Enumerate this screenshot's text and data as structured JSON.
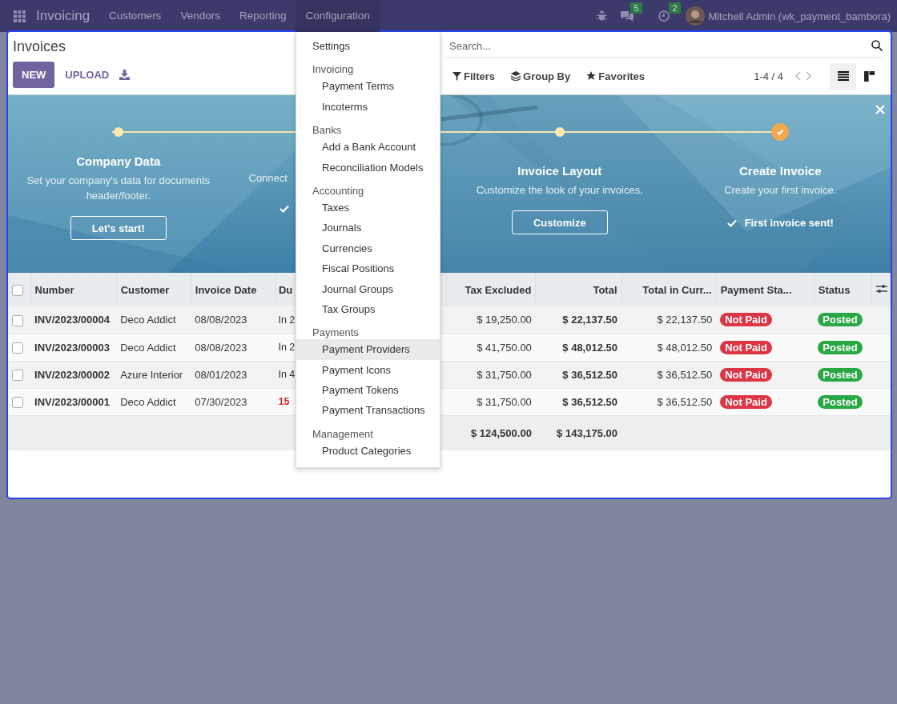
{
  "navbar": {
    "app_name": "Invoicing",
    "menus": [
      {
        "label": "Customers",
        "selected": false
      },
      {
        "label": "Vendors",
        "selected": false
      },
      {
        "label": "Reporting",
        "selected": false
      },
      {
        "label": "Configuration",
        "selected": true
      }
    ],
    "messages_badge": "5",
    "activities_badge": "2",
    "user": "Mitchell Admin (wk_payment_bambora)"
  },
  "control_panel": {
    "title": "Invoices",
    "new_button": "NEW",
    "upload_button": "UPLOAD",
    "search": {
      "placeholder": "Search..."
    },
    "filters": "Filters",
    "group_by": "Group By",
    "favorites": "Favorites",
    "pager": "1-4 / 4",
    "views": [
      {
        "kind": "list",
        "selected": true
      },
      {
        "kind": "kanban",
        "selected": false
      }
    ]
  },
  "onboarding": {
    "steps": [
      {
        "title": "Company Data",
        "description": "Set your company's data for documents header/footer.",
        "button": "Let's start!",
        "done": false
      },
      {
        "description": "Connect",
        "done": true
      },
      {
        "title": "Invoice Layout",
        "description": "Customize the look of your invoices.",
        "button": "Customize",
        "done": false
      },
      {
        "title": "Create Invoice",
        "description": "Create your first invoice.",
        "done": true,
        "done_label": "First invoice sent!"
      }
    ]
  },
  "table": {
    "select_all_checked": false,
    "columns": [
      "Number",
      "Customer",
      "Invoice Date",
      "Du",
      "Tax Excluded",
      "Total",
      "Total in Curr...",
      "Payment Sta...",
      "Status"
    ],
    "rows": [
      {
        "checked": false,
        "number": "INV/2023/00004",
        "customer": "Deco Addict",
        "invoice_date": "08/08/2023",
        "due": "In 2",
        "overdue": false,
        "tax_excluded": "$ 19,250.00",
        "total": "$ 22,137.50",
        "total_currency": "$ 22,137.50",
        "payment_status": {
          "label": "Not Paid",
          "color": "#dc3545"
        },
        "status": {
          "label": "Posted",
          "color": "#28a745"
        }
      },
      {
        "checked": false,
        "number": "INV/2023/00003",
        "customer": "Deco Addict",
        "invoice_date": "08/08/2023",
        "due": "In 2",
        "overdue": false,
        "tax_excluded": "$ 41,750.00",
        "total": "$ 48,012.50",
        "total_currency": "$ 48,012.50",
        "payment_status": {
          "label": "Not Paid",
          "color": "#dc3545"
        },
        "status": {
          "label": "Posted",
          "color": "#28a745"
        }
      },
      {
        "checked": false,
        "number": "INV/2023/00002",
        "customer": "Azure Interior",
        "invoice_date": "08/01/2023",
        "due": "In 4",
        "overdue": false,
        "tax_excluded": "$ 31,750.00",
        "total": "$ 36,512.50",
        "total_currency": "$ 36,512.50",
        "payment_status": {
          "label": "Not Paid",
          "color": "#dc3545"
        },
        "status": {
          "label": "Posted",
          "color": "#28a745"
        }
      },
      {
        "checked": false,
        "number": "INV/2023/00001",
        "customer": "Deco Addict",
        "invoice_date": "07/30/2023",
        "due": "15",
        "overdue": true,
        "tax_excluded": "$ 31,750.00",
        "total": "$ 36,512.50",
        "total_currency": "$ 36,512.50",
        "payment_status": {
          "label": "Not Paid",
          "color": "#dc3545"
        },
        "status": {
          "label": "Posted",
          "color": "#28a745"
        }
      }
    ],
    "totals": {
      "tax_excluded": "$ 124,500.00",
      "total": "$ 143,175.00"
    }
  },
  "config_menu": {
    "items": [
      {
        "kind": "item",
        "label": "Settings",
        "selected": false
      },
      {
        "kind": "header",
        "label": "Invoicing"
      },
      {
        "kind": "subitem",
        "label": "Payment Terms",
        "selected": false
      },
      {
        "kind": "subitem",
        "label": "Incoterms",
        "selected": false
      },
      {
        "kind": "header",
        "label": "Banks"
      },
      {
        "kind": "subitem",
        "label": "Add a Bank Account",
        "selected": false
      },
      {
        "kind": "subitem",
        "label": "Reconciliation Models",
        "selected": false
      },
      {
        "kind": "header",
        "label": "Accounting"
      },
      {
        "kind": "subitem",
        "label": "Taxes",
        "selected": false
      },
      {
        "kind": "subitem",
        "label": "Journals",
        "selected": false
      },
      {
        "kind": "subitem",
        "label": "Currencies",
        "selected": false
      },
      {
        "kind": "subitem",
        "label": "Fiscal Positions",
        "selected": false
      },
      {
        "kind": "subitem",
        "label": "Journal Groups",
        "selected": false
      },
      {
        "kind": "subitem",
        "label": "Tax Groups",
        "selected": false
      },
      {
        "kind": "header",
        "label": "Payments"
      },
      {
        "kind": "subitem",
        "label": "Payment Providers",
        "selected": true
      },
      {
        "kind": "subitem",
        "label": "Payment Icons",
        "selected": false
      },
      {
        "kind": "subitem",
        "label": "Payment Tokens",
        "selected": false
      },
      {
        "kind": "subitem",
        "label": "Payment Transactions",
        "selected": false
      },
      {
        "kind": "header",
        "label": "Management"
      },
      {
        "kind": "subitem",
        "label": "Product Categories",
        "selected": false
      }
    ]
  }
}
